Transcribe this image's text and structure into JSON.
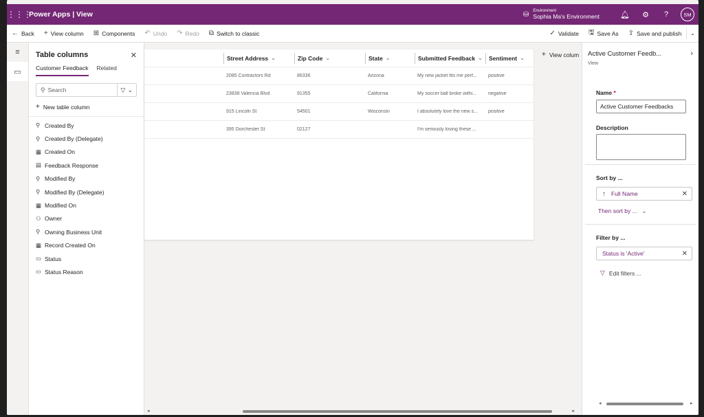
{
  "topbar": {
    "app_title": "Power Apps  |  View",
    "env_label": "Environment",
    "env_name": "Sophia Ma's Environment",
    "avatar_initials": "SM"
  },
  "cmdbar": {
    "back": "Back",
    "view_column": "View column",
    "components": "Components",
    "undo": "Undo",
    "redo": "Redo",
    "switch_classic": "Switch to classic",
    "validate": "Validate",
    "save_as": "Save As",
    "save_publish": "Save and publish"
  },
  "columns_panel": {
    "title": "Table columns",
    "tabs": [
      "Customer Feedback",
      "Related"
    ],
    "search_placeholder": "Search",
    "new_column": "New table column",
    "items": [
      {
        "label": "Created By",
        "icon": "lookup-icon"
      },
      {
        "label": "Created By (Delegate)",
        "icon": "lookup-icon"
      },
      {
        "label": "Created On",
        "icon": "calendar-icon"
      },
      {
        "label": "Feedback Response",
        "icon": "text-field-icon"
      },
      {
        "label": "Modified By",
        "icon": "lookup-icon"
      },
      {
        "label": "Modified By (Delegate)",
        "icon": "lookup-icon"
      },
      {
        "label": "Modified On",
        "icon": "calendar-icon"
      },
      {
        "label": "Owner",
        "icon": "person-icon"
      },
      {
        "label": "Owning Business Unit",
        "icon": "lookup-icon"
      },
      {
        "label": "Record Created On",
        "icon": "calendar-icon"
      },
      {
        "label": "Status",
        "icon": "choice-icon"
      },
      {
        "label": "Status Reason",
        "icon": "choice-icon"
      }
    ]
  },
  "grid": {
    "headers": [
      "",
      "Street Address",
      "Zip Code",
      "State",
      "Submitted Feedback",
      "Sentiment"
    ],
    "rows": [
      [
        "",
        "2085 Contractors Rd",
        "86336",
        "Arizona",
        "My new jacket fits me perf...",
        "positive"
      ],
      [
        "",
        "23838 Valencia Blvd",
        "91355",
        "California",
        "My soccer ball broke withi...",
        "negative"
      ],
      [
        "",
        "915 Lincoln St",
        "54501",
        "Wisconsin",
        "I absolutely love the new s...",
        "positive"
      ],
      [
        "",
        "395 Dorchester St",
        "02127",
        "",
        "I'm seriously loving these ...",
        ""
      ]
    ],
    "view_column": "View colum"
  },
  "props": {
    "title": "Active Customer Feedb...",
    "subtitle": "View",
    "name_label": "Name",
    "name_required": "*",
    "name_value": "Active Customer Feedbacks",
    "description_label": "Description",
    "sort_label": "Sort by ...",
    "sort_value": "Full Name",
    "then_sort": "Then sort by ...",
    "filter_label": "Filter by ...",
    "filter_value": "Status is 'Active'",
    "edit_filters": "Edit filters ..."
  }
}
